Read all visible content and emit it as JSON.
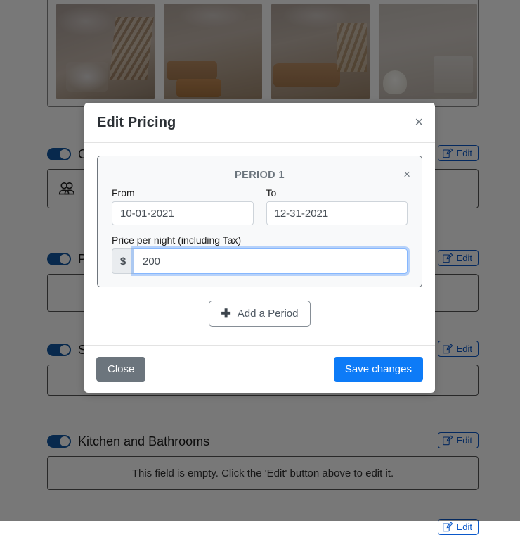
{
  "background": {
    "gallery": {
      "photos": [
        {
          "name": "photo-dining-staircase"
        },
        {
          "name": "photo-living-room-sofas"
        },
        {
          "name": "photo-living-room-large-sofa"
        },
        {
          "name": "photo-bathroom"
        }
      ]
    },
    "edit_label": "Edit",
    "empty_field_note": "This field is empty. Click the 'Edit' button above to edit it.",
    "sections": [
      {
        "title": "Capacity",
        "toggle_on": true,
        "content_icon": "guests-icon"
      },
      {
        "title": "Pricing",
        "toggle_on": true,
        "content_icon": ""
      },
      {
        "title": "Sleeping",
        "toggle_on": true,
        "content_icon": ""
      },
      {
        "title": "Kitchen and Bathrooms",
        "toggle_on": true,
        "content_icon": ""
      }
    ]
  },
  "modal": {
    "title": "Edit Pricing",
    "close_icon": "×",
    "period": {
      "title": "PERIOD 1",
      "remove_icon": "×",
      "from_label": "From",
      "from_value": "10-01-2021",
      "to_label": "To",
      "to_value": "12-31-2021",
      "price_label": "Price per night (including Tax)",
      "currency_symbol": "$",
      "price_value": "200"
    },
    "add_period_label": "Add a Period",
    "add_period_icon": "✚",
    "footer": {
      "close_label": "Close",
      "save_label": "Save changes"
    }
  },
  "colors": {
    "accent_blue": "#0d7bf7",
    "edit_blue": "#0a58ca",
    "toggle_on": "#1157a3",
    "close_gray": "#6c757d",
    "card_bg": "#f8f9fa",
    "backdrop": "rgba(0,0,0,0.53)"
  }
}
